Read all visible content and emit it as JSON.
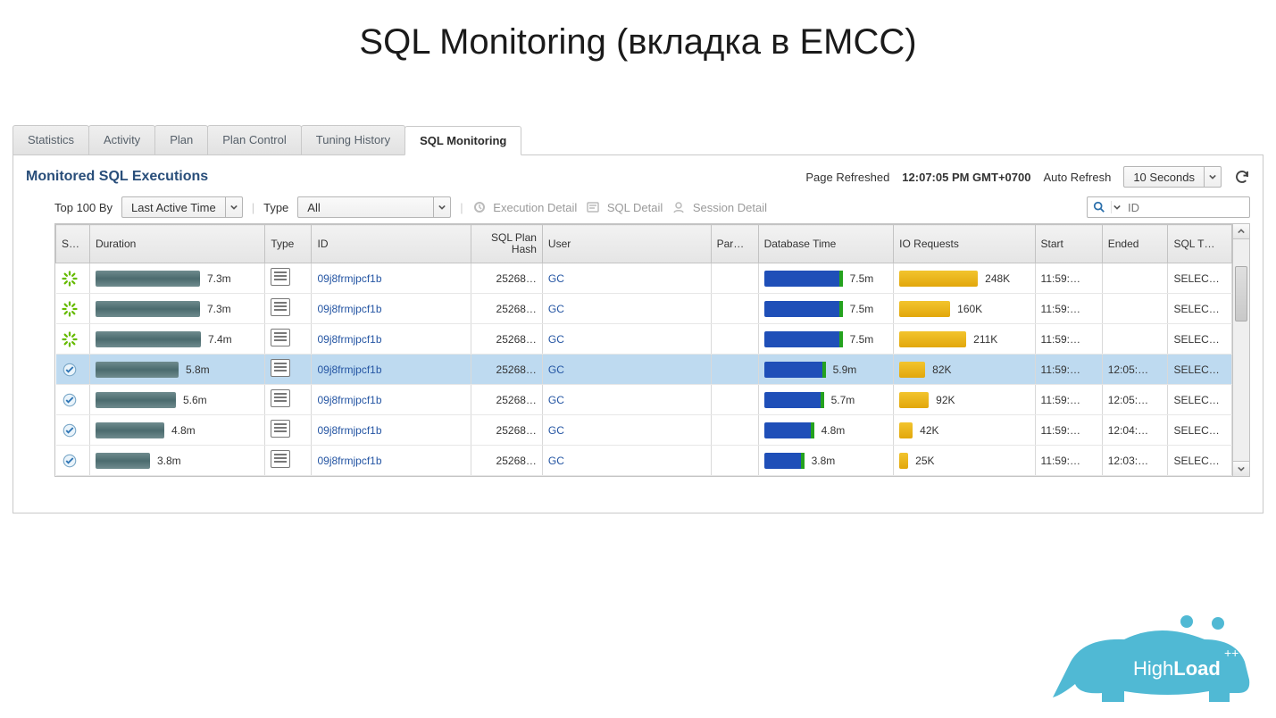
{
  "slide_title": "SQL Monitoring (вкладка в EMCC)",
  "tabs": [
    "Statistics",
    "Activity",
    "Plan",
    "Plan Control",
    "Tuning History",
    "SQL Monitoring"
  ],
  "active_tab": 5,
  "section_title": "Monitored SQL Executions",
  "page_refreshed_label": "Page Refreshed",
  "page_refreshed_time": "12:07:05 PM GMT+0700",
  "auto_refresh_label": "Auto Refresh",
  "auto_refresh_value": "10 Seconds",
  "toolbar": {
    "top100_label": "Top 100 By",
    "top100_value": "Last Active Time",
    "type_label": "Type",
    "type_value": "All",
    "exec_detail": "Execution Detail",
    "sql_detail": "SQL Detail",
    "session_detail": "Session Detail",
    "search_placeholder": "ID"
  },
  "columns": {
    "status": "S…",
    "duration": "Duration",
    "type": "Type",
    "id": "ID",
    "hash": "SQL Plan\nHash",
    "user": "User",
    "par": "Par…",
    "db": "Database Time",
    "io": "IO Requests",
    "start": "Start",
    "end": "Ended",
    "sqlt": "SQL T…"
  },
  "max_duration": 7.5,
  "max_db": 7.5,
  "max_io": 248,
  "rows": [
    {
      "status": "running",
      "duration": "7.3m",
      "duration_v": 7.3,
      "id": "09j8frmjpcf1b",
      "hash": "25268…",
      "user": "GC",
      "db": "7.5m",
      "db_v": 7.5,
      "io": "248K",
      "io_v": 248,
      "start": "11:59:…",
      "end": "",
      "sqlt": "SELEC…"
    },
    {
      "status": "running",
      "duration": "7.3m",
      "duration_v": 7.3,
      "id": "09j8frmjpcf1b",
      "hash": "25268…",
      "user": "GC",
      "db": "7.5m",
      "db_v": 7.5,
      "io": "160K",
      "io_v": 160,
      "start": "11:59:…",
      "end": "",
      "sqlt": "SELEC…"
    },
    {
      "status": "running",
      "duration": "7.4m",
      "duration_v": 7.4,
      "id": "09j8frmjpcf1b",
      "hash": "25268…",
      "user": "GC",
      "db": "7.5m",
      "db_v": 7.5,
      "io": "211K",
      "io_v": 211,
      "start": "11:59:…",
      "end": "",
      "sqlt": "SELEC…"
    },
    {
      "status": "done",
      "selected": true,
      "duration": "5.8m",
      "duration_v": 5.8,
      "id": "09j8frmjpcf1b",
      "hash": "25268…",
      "user": "GC",
      "db": "5.9m",
      "db_v": 5.9,
      "io": "82K",
      "io_v": 82,
      "start": "11:59:…",
      "end": "12:05:…",
      "sqlt": "SELEC…"
    },
    {
      "status": "done",
      "duration": "5.6m",
      "duration_v": 5.6,
      "id": "09j8frmjpcf1b",
      "hash": "25268…",
      "user": "GC",
      "db": "5.7m",
      "db_v": 5.7,
      "io": "92K",
      "io_v": 92,
      "start": "11:59:…",
      "end": "12:05:…",
      "sqlt": "SELEC…"
    },
    {
      "status": "done",
      "duration": "4.8m",
      "duration_v": 4.8,
      "id": "09j8frmjpcf1b",
      "hash": "25268…",
      "user": "GC",
      "db": "4.8m",
      "db_v": 4.8,
      "io": "42K",
      "io_v": 42,
      "start": "11:59:…",
      "end": "12:04:…",
      "sqlt": "SELEC…"
    },
    {
      "status": "done",
      "duration": "3.8m",
      "duration_v": 3.8,
      "id": "09j8frmjpcf1b",
      "hash": "25268…",
      "user": "GC",
      "db": "3.8m",
      "db_v": 3.8,
      "io": "25K",
      "io_v": 25,
      "start": "11:59:…",
      "end": "12:03:…",
      "sqlt": "SELEC…"
    }
  ],
  "logo_text": {
    "a": "High",
    "b": "Load",
    "c": "++"
  }
}
